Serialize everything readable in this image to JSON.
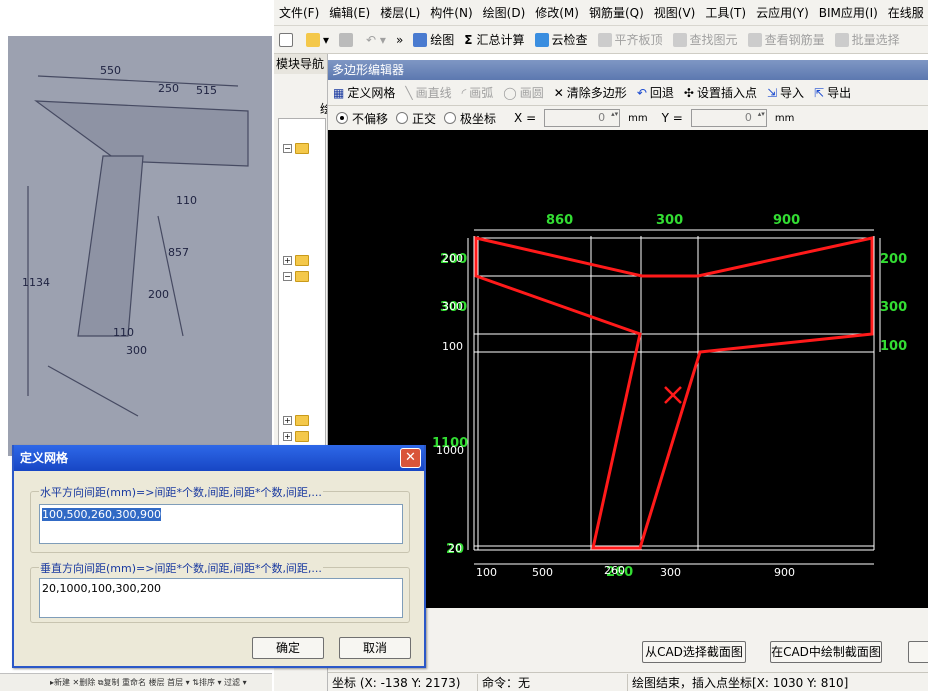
{
  "menu": [
    "文件(F)",
    "编辑(E)",
    "楼层(L)",
    "构件(N)",
    "绘图(D)",
    "修改(M)",
    "钢筋量(Q)",
    "视图(V)",
    "工具(T)",
    "云应用(Y)",
    "BIM应用(I)",
    "在线服"
  ],
  "toolbar": {
    "draw": "绘图",
    "sum": "汇总计算",
    "cloud_check": "云检查",
    "flat_board": "平齐板顶",
    "find": "查找图元",
    "view_rebar": "查看钢筋量",
    "batch": "批量选择"
  },
  "nav": {
    "title": "模块导航",
    "sub": "绘"
  },
  "editor": {
    "title": "多边形编辑器",
    "tools": {
      "define_grid": "定义网格",
      "line": "画直线",
      "arc": "画弧",
      "circle": "画圆",
      "clear": "清除多边形",
      "undo": "回退",
      "insert_point": "设置插入点",
      "import": "导入",
      "export": "导出"
    },
    "modes": {
      "no_offset": "不偏移",
      "ortho": "正交",
      "polar": "极坐标"
    },
    "x_label": "X =",
    "y_label": "Y =",
    "x_value": "0",
    "y_value": "0",
    "unit": "mm",
    "btn_from_cad": "从CAD选择截面图",
    "btn_draw_cad": "在CAD中绘制截面图"
  },
  "status": {
    "coord": "坐标 (X: -138 Y: 2173)",
    "cmd": "命令：无",
    "msg": "绘图结束，插入点坐标[X: 1030 Y: 810]"
  },
  "dialog": {
    "title": "定义网格",
    "h_label": "水平方向间距(mm)=>间距*个数,间距,间距*个数,间距,...",
    "h_value": "100,500,260,300,900",
    "v_label": "垂直方向间距(mm)=>间距*个数,间距,间距*个数,间距,...",
    "v_value": "20,1000,100,300,200",
    "ok": "确定",
    "cancel": "取消"
  },
  "drawing": {
    "top_dims": [
      "860",
      "300",
      "900"
    ],
    "bottom_dims": [
      "100",
      "500",
      "260",
      "300",
      "900"
    ],
    "bottom_green": "260",
    "left_dims": [
      "200",
      "300",
      "100",
      "1000",
      "20"
    ],
    "left_green": [
      "200",
      "300",
      "1100",
      "20"
    ],
    "right_dims": [
      "200",
      "300",
      "100"
    ]
  },
  "photo": {
    "dims": [
      "550",
      "250",
      "515",
      "1134",
      "857",
      "200",
      "110",
      "300",
      "110"
    ]
  },
  "colors": {
    "grid": "#ffffff",
    "shape": "#ff1a1a",
    "dim_green": "#33dd33",
    "canvas": "#000000"
  }
}
